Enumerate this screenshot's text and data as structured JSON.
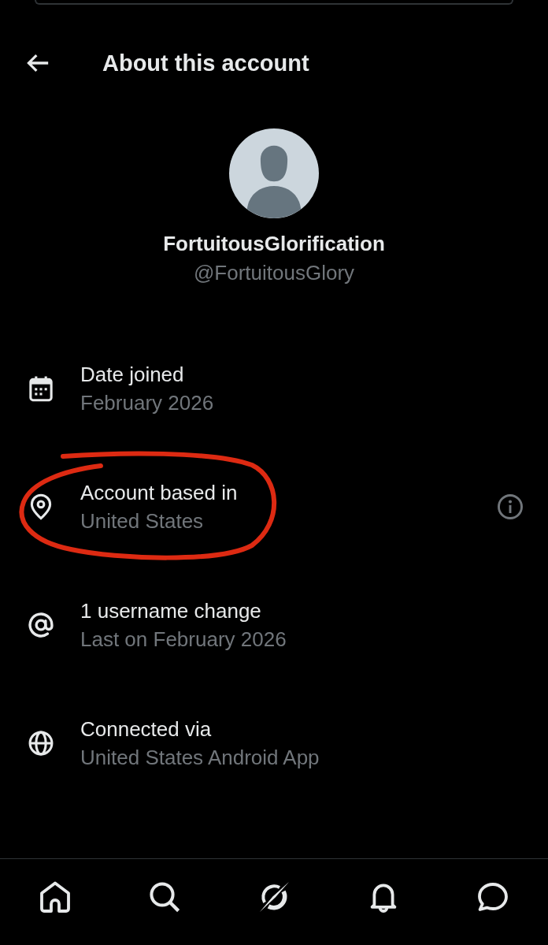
{
  "header": {
    "title": "About this account"
  },
  "profile": {
    "display_name": "FortuitousGlorification",
    "handle": "@FortuitousGlory"
  },
  "details": [
    {
      "kind": "date_joined",
      "label": "Date joined",
      "value": "February 2026",
      "info_button": false,
      "circled": false
    },
    {
      "kind": "location",
      "label": "Account based in",
      "value": "United States",
      "info_button": true,
      "circled": true
    },
    {
      "kind": "username_changes",
      "label": "1 username change",
      "value": "Last on February 2026",
      "info_button": false,
      "circled": false
    },
    {
      "kind": "connection",
      "label": "Connected via",
      "value": "United States Android App",
      "info_button": false,
      "circled": false
    }
  ]
}
